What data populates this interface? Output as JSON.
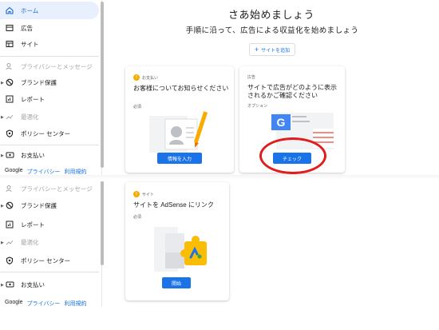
{
  "sidebar_top": {
    "items": [
      {
        "label": "ホーム",
        "icon": "home-icon"
      },
      {
        "label": "広告",
        "icon": "ads-icon"
      },
      {
        "label": "サイト",
        "icon": "sites-icon"
      },
      {
        "label": "プライバシーとメッセージ",
        "icon": "privacy-icon"
      },
      {
        "label": "ブランド保護",
        "icon": "block-icon"
      },
      {
        "label": "レポート",
        "icon": "reports-icon"
      },
      {
        "label": "最適化",
        "icon": "optimize-icon"
      },
      {
        "label": "ポリシー センター",
        "icon": "policy-icon"
      },
      {
        "label": "お支払い",
        "icon": "payments-icon"
      }
    ]
  },
  "sidebar_bottom": {
    "items": [
      {
        "label": "プライバシーとメッセージ",
        "icon": "privacy-icon"
      },
      {
        "label": "ブランド保護",
        "icon": "block-icon"
      },
      {
        "label": "レポート",
        "icon": "reports-icon"
      },
      {
        "label": "最適化",
        "icon": "optimize-icon"
      },
      {
        "label": "ポリシー センター",
        "icon": "policy-icon"
      },
      {
        "label": "お支払い",
        "icon": "payments-icon"
      }
    ]
  },
  "footer": {
    "brand": "Google",
    "privacy": "プライバシー",
    "terms": "利用規約"
  },
  "main": {
    "title": "さあ始めましょう",
    "subtitle": "手順に沿って、広告による収益化を始めましょう",
    "add_site": "サイトを追加"
  },
  "cards": {
    "payments": {
      "chip": "お支払い",
      "title": "お客様についてお知らせください",
      "tag": "必須",
      "button": "情報を入力"
    },
    "ads": {
      "chip": "広告",
      "title": "サイトで広告がどのように表示されるかご確認ください",
      "tag": "オプション",
      "button": "チェック"
    },
    "site": {
      "chip": "サイト",
      "title": "サイトを AdSense にリンク",
      "tag": "必須",
      "button": "開始"
    }
  },
  "colors": {
    "accent": "#1a73e8",
    "active_bg": "#e8f0fe",
    "chip_yellow": "#f9ab00",
    "annotation_red": "#e11c1c"
  }
}
